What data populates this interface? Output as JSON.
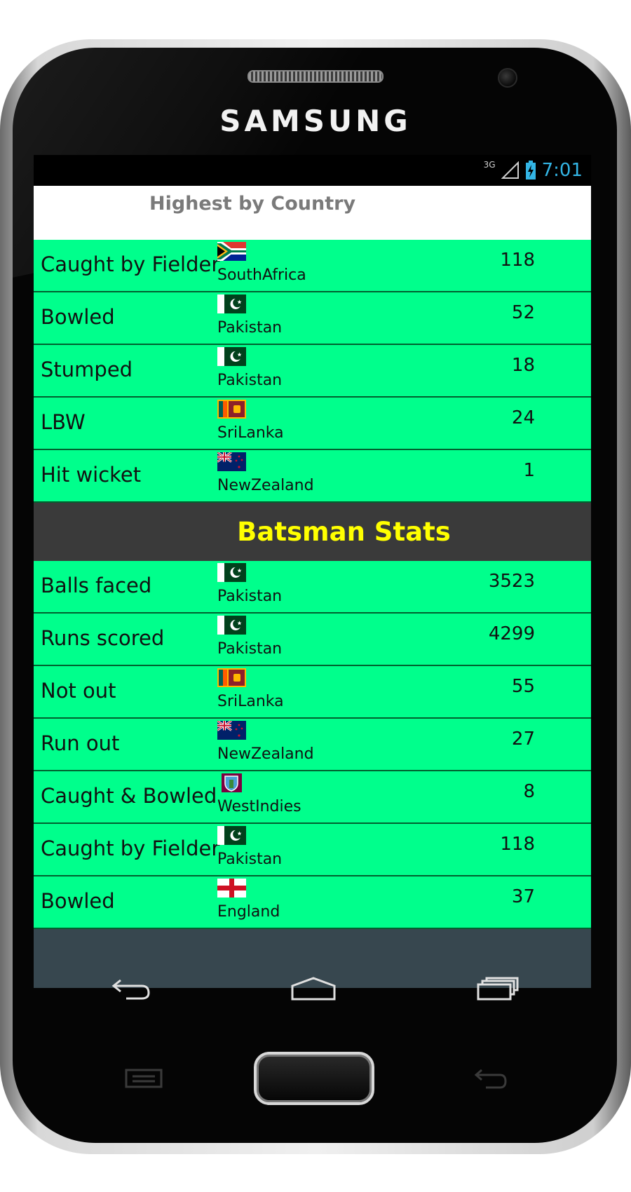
{
  "device": {
    "brand": "SAMSUNG"
  },
  "status_bar": {
    "network": "3G",
    "time": "7:01"
  },
  "header": {
    "title": "Highest by Country"
  },
  "colors": {
    "row_background": "#00ff8c",
    "section_background": "#3a3a3a",
    "section_title": "#ffff00",
    "clock": "#33b5e5"
  },
  "bowling_rows": [
    {
      "label": "Caught by Fielder",
      "country": "SouthAfrica",
      "flag_icon": "south-africa-flag-icon",
      "value": "118"
    },
    {
      "label": "Bowled",
      "country": "Pakistan",
      "flag_icon": "pakistan-flag-icon",
      "value": "52"
    },
    {
      "label": "Stumped",
      "country": "Pakistan",
      "flag_icon": "pakistan-flag-icon",
      "value": "18"
    },
    {
      "label": "LBW",
      "country": "SriLanka",
      "flag_icon": "sri-lanka-flag-icon",
      "value": "24"
    },
    {
      "label": "Hit wicket",
      "country": "NewZealand",
      "flag_icon": "new-zealand-flag-icon",
      "value": "1"
    }
  ],
  "batsman_section": {
    "title": "Batsman Stats"
  },
  "batsman_rows": [
    {
      "label": "Balls faced",
      "country": "Pakistan",
      "flag_icon": "pakistan-flag-icon",
      "value": "3523"
    },
    {
      "label": "Runs scored",
      "country": "Pakistan",
      "flag_icon": "pakistan-flag-icon",
      "value": "4299"
    },
    {
      "label": "Not out",
      "country": "SriLanka",
      "flag_icon": "sri-lanka-flag-icon",
      "value": "55"
    },
    {
      "label": "Run out",
      "country": "NewZealand",
      "flag_icon": "new-zealand-flag-icon",
      "value": "27"
    },
    {
      "label": "Caught & Bowled",
      "country": "WestIndies",
      "flag_icon": "west-indies-flag-icon",
      "value": "8"
    },
    {
      "label": "Caught by Fielder",
      "country": "Pakistan",
      "flag_icon": "pakistan-flag-icon",
      "value": "118"
    },
    {
      "label": "Bowled",
      "country": "England",
      "flag_icon": "england-flag-icon",
      "value": "37"
    }
  ],
  "nav_icons": [
    "back-icon",
    "home-icon",
    "recent-apps-icon"
  ]
}
